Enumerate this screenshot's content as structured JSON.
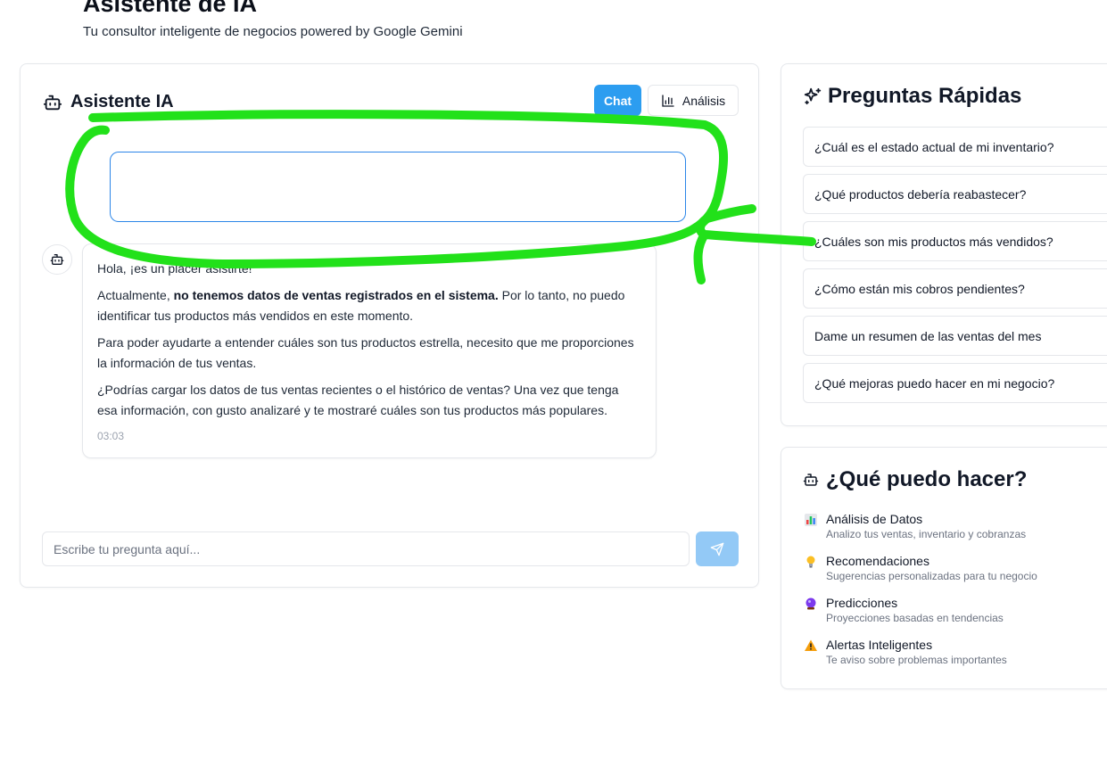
{
  "header": {
    "title": "Asistente de IA",
    "subtitle": "Tu consultor inteligente de negocios powered by Google Gemini"
  },
  "chat": {
    "title": "Asistente IA",
    "tabs": {
      "chat": "Chat",
      "analysis": "Análisis"
    },
    "bot_message": {
      "greeting": "Hola, ¡es un placer asistirte!",
      "p2_prefix": "Actualmente, ",
      "p2_bold": "no tenemos datos de ventas registrados en el sistema.",
      "p2_suffix": " Por lo tanto, no puedo identificar tus productos más vendidos en este momento.",
      "p3": "Para poder ayudarte a entender cuáles son tus productos estrella, necesito que me proporciones la información de tus ventas.",
      "p4": "¿Podrías cargar los datos de tus ventas recientes o el histórico de ventas? Una vez que tenga esa información, con gusto analizaré y te mostraré cuáles son tus productos más populares.",
      "time": "03:03"
    },
    "input_placeholder": "Escribe tu pregunta aquí..."
  },
  "quick_questions": {
    "title": "Preguntas Rápidas",
    "items": [
      "¿Cuál es el estado actual de mi inventario?",
      "¿Qué productos debería reabastecer?",
      "¿Cuáles son mis productos más vendidos?",
      "¿Cómo están mis cobros pendientes?",
      "Dame un resumen de las ventas del mes",
      "¿Qué mejoras puedo hacer en mi negocio?"
    ]
  },
  "capabilities": {
    "title": "¿Qué puedo hacer?",
    "items": [
      {
        "icon": "bar-chart-emoji-icon",
        "title": "Análisis de Datos",
        "desc": "Analizo tus ventas, inventario y cobranzas"
      },
      {
        "icon": "lightbulb-emoji-icon",
        "title": "Recomendaciones",
        "desc": "Sugerencias personalizadas para tu negocio"
      },
      {
        "icon": "crystal-ball-emoji-icon",
        "title": "Predicciones",
        "desc": "Proyecciones basadas en tendencias"
      },
      {
        "icon": "warning-emoji-icon",
        "title": "Alertas Inteligentes",
        "desc": "Te aviso sobre problemas importantes"
      }
    ]
  },
  "colors": {
    "accent": "#2c9df0",
    "send_disabled": "#93c9f6",
    "annotation": "#22e11a"
  }
}
